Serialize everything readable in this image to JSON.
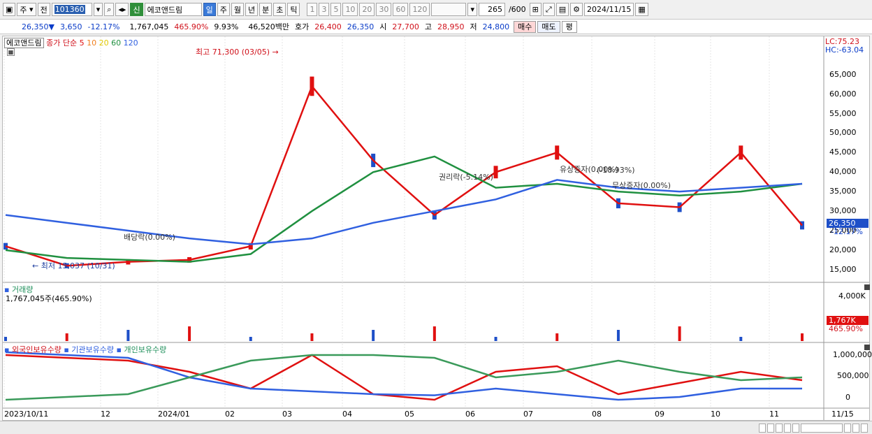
{
  "toolbar": {
    "market": "주",
    "prefix": "전",
    "code": "101360",
    "badge": "신",
    "stock_name": "에코앤드림",
    "periods": [
      "일",
      "주",
      "월",
      "년",
      "분",
      "초",
      "틱"
    ],
    "active_period": "일",
    "intervals": [
      "1",
      "3",
      "5",
      "10",
      "20",
      "30",
      "60",
      "120"
    ],
    "bar_count": "265",
    "bar_total": "/600",
    "date": "2024/11/15"
  },
  "quote": {
    "price": "26,350",
    "change": "3,650",
    "change_pct": "-12.17%",
    "volume": "1,767,045",
    "volume_ratio": "465.90%",
    "turnover": "9.93%",
    "amount": "46,520백만",
    "bid_label": "호가",
    "ask_price": "26,400",
    "bid_price": "26,350",
    "open_label": "시",
    "open": "27,700",
    "high_label": "고",
    "high": "28,950",
    "low_label": "저",
    "low": "24,800",
    "buy_label": "매수",
    "sell_label": "매도",
    "eval_label": "평"
  },
  "price_panel": {
    "stock_name": "에코앤드림",
    "ma_label": "종가 단순",
    "ma_periods": [
      "5",
      "10",
      "20",
      "60",
      "120"
    ],
    "ma_colors": [
      "#e01010",
      "#f08020",
      "#f0e020",
      "#209040",
      "#3060e0"
    ],
    "lc": "LC:75.23",
    "hc": "HC:-63.04",
    "y_ticks": [
      "65,000",
      "60,000",
      "55,000",
      "50,000",
      "45,000",
      "40,000",
      "35,000",
      "30,000",
      "25,000",
      "20,000",
      "15,000"
    ],
    "current_price": "26,350",
    "current_pct": "-12.17%",
    "annotations": {
      "high": "최고 71,300 (03/05)",
      "low": "최저 15,037 (10/31)",
      "dividend": "배당락(0.00%)",
      "rights": "권리락(-5.14%)",
      "paid_increase": "유상증자(0.00%)",
      "free_increase": "무상증자(0.00%)",
      "mixed": "(-18.93%)"
    }
  },
  "volume_panel": {
    "title": "거래량",
    "value": "1,767,045주(465.90%)",
    "y_ticks": [
      "4,000K"
    ],
    "cur": "1,767K",
    "cur_pct": "465.90%"
  },
  "holdings_panel": {
    "series": [
      "외국인보유수량",
      "기관보유수량",
      "개인보유수량"
    ],
    "colors": [
      "#e01010",
      "#3060e0",
      "#3a9a5a"
    ],
    "y_ticks": [
      "1,000,000",
      "500,000",
      "0"
    ]
  },
  "x_axis": {
    "labels": [
      "2023/10/11",
      "12",
      "2024/01",
      "02",
      "03",
      "04",
      "05",
      "06",
      "07",
      "08",
      "09",
      "10",
      "11"
    ],
    "right_label": "11/15"
  },
  "chart_data": {
    "type": "line",
    "title": "에코앤드림",
    "x": [
      "2023/10",
      "11",
      "12",
      "2024/01",
      "02",
      "03",
      "04",
      "05",
      "06",
      "07",
      "08",
      "09",
      "10",
      "11"
    ],
    "series": [
      {
        "name": "5",
        "values": [
          21000,
          16000,
          17000,
          17500,
          21000,
          62000,
          43000,
          29000,
          40000,
          45000,
          32000,
          31000,
          45000,
          26350
        ]
      },
      {
        "name": "60",
        "values": [
          20000,
          18000,
          17500,
          17000,
          19000,
          30000,
          40000,
          44000,
          36000,
          37000,
          35000,
          34000,
          35000,
          37000
        ]
      },
      {
        "name": "120",
        "values": [
          29000,
          27000,
          25000,
          23000,
          21500,
          23000,
          27000,
          30000,
          33000,
          38000,
          36000,
          35000,
          36000,
          37000
        ]
      }
    ],
    "ylim": [
      13000,
      73000
    ]
  }
}
